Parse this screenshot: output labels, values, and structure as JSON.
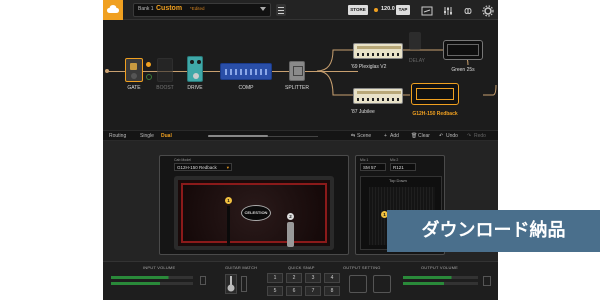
{
  "topbar": {
    "bank": "Bank 1",
    "preset_name": "Custom",
    "edited_flag": "*Edited",
    "store_label": "STORE",
    "tempo": "120.0",
    "tap_label": "TAP"
  },
  "chain": {
    "pedals": [
      {
        "label": "GATE",
        "active": true
      },
      {
        "label": "BOOST",
        "active": false
      },
      {
        "label": "DRIVE",
        "active": true
      },
      {
        "label": "COMP",
        "active": true
      },
      {
        "label": "SPLITTER",
        "active": true
      }
    ],
    "amps": [
      {
        "label": "'69 Plexiglas V2",
        "selected": false
      },
      {
        "label": "'87 Jubilee",
        "selected": false
      },
      {
        "label": "G12H-150 Redback",
        "selected": true
      },
      {
        "label": "Green 25s",
        "selected": false
      }
    ],
    "delay_label": "DELAY"
  },
  "routing": {
    "label": "Routing",
    "single": "Single",
    "dual": "Dual",
    "scene": "Scene",
    "add": "Add",
    "clear": "Clear",
    "undo": "Undo",
    "redo": "Redo"
  },
  "cab": {
    "left_title": "Cab Model",
    "left_model": "G12H-150 Redback",
    "speaker_brand": "CELESTION",
    "mic1_num": "1",
    "mic2_num": "2",
    "right_mic1_label": "Mic 1",
    "right_mic1": "SM 57",
    "right_mic2_label": "Mic 2",
    "right_mic2": "R121",
    "right_tab": "Top Down",
    "right_mic_num": "1"
  },
  "bottom": {
    "input_volume": "INPUT VOLUME",
    "guitar_match": "GUITAR MATCH",
    "quick_snap": "QUICK SNAP",
    "output_setting": "OUTPUT SETTING",
    "output_volume": "OUTPUT VOLUME",
    "snaps": [
      "1",
      "2",
      "3",
      "4",
      "5",
      "6",
      "7",
      "8"
    ]
  },
  "overlay": {
    "badge_text": "ダウンロード納品"
  },
  "colors": {
    "accent": "#f0a020",
    "badge_bg": "#4a6f8c",
    "cab_red": "#8b1a1a"
  }
}
